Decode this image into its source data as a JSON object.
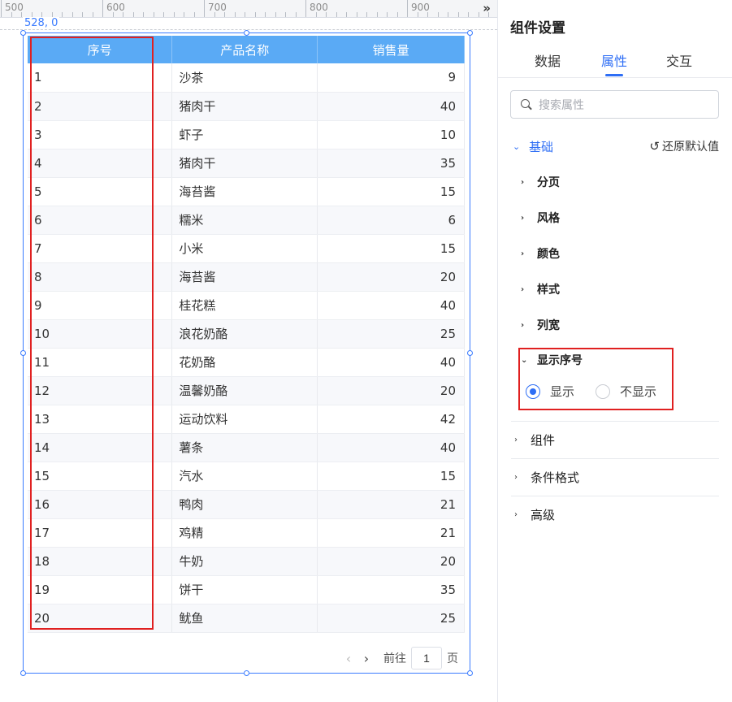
{
  "ruler": {
    "labels": [
      "500",
      "600",
      "700",
      "800",
      "900"
    ]
  },
  "canvas": {
    "coord_readout": "528, 0"
  },
  "table": {
    "headers": [
      "序号",
      "产品名称",
      "销售量"
    ],
    "rows": [
      [
        "1",
        "沙茶",
        "9"
      ],
      [
        "2",
        "猪肉干",
        "40"
      ],
      [
        "3",
        "虾子",
        "10"
      ],
      [
        "4",
        "猪肉干",
        "35"
      ],
      [
        "5",
        "海苔酱",
        "15"
      ],
      [
        "6",
        "糯米",
        "6"
      ],
      [
        "7",
        "小米",
        "15"
      ],
      [
        "8",
        "海苔酱",
        "20"
      ],
      [
        "9",
        "桂花糕",
        "40"
      ],
      [
        "10",
        "浪花奶酪",
        "25"
      ],
      [
        "11",
        "花奶酪",
        "40"
      ],
      [
        "12",
        "温馨奶酪",
        "20"
      ],
      [
        "13",
        "运动饮料",
        "42"
      ],
      [
        "14",
        "薯条",
        "40"
      ],
      [
        "15",
        "汽水",
        "15"
      ],
      [
        "16",
        "鸭肉",
        "21"
      ],
      [
        "17",
        "鸡精",
        "21"
      ],
      [
        "18",
        "牛奶",
        "20"
      ],
      [
        "19",
        "饼干",
        "35"
      ],
      [
        "20",
        "鱿鱼",
        "25"
      ]
    ]
  },
  "pager": {
    "goto_label": "前往",
    "page_value": "1",
    "page_suffix": "页"
  },
  "panel": {
    "title": "组件设置",
    "tabs": [
      {
        "label": "数据",
        "active": false
      },
      {
        "label": "属性",
        "active": true
      },
      {
        "label": "交互",
        "active": false
      }
    ],
    "search": {
      "placeholder": "搜索属性"
    },
    "section": {
      "title": "基础",
      "reset_label": "还原默认值"
    },
    "sub_items": [
      "分页",
      "风格",
      "颜色",
      "样式",
      "列宽"
    ],
    "show_index": {
      "title": "显示序号",
      "options": [
        {
          "label": "显示",
          "checked": true
        },
        {
          "label": "不显示",
          "checked": false
        }
      ]
    },
    "groups": [
      "组件",
      "条件格式",
      "高级"
    ]
  },
  "colors": {
    "accent": "#2e6ef5",
    "header_bg": "#5aaaf5",
    "highlight": "#e02020"
  }
}
